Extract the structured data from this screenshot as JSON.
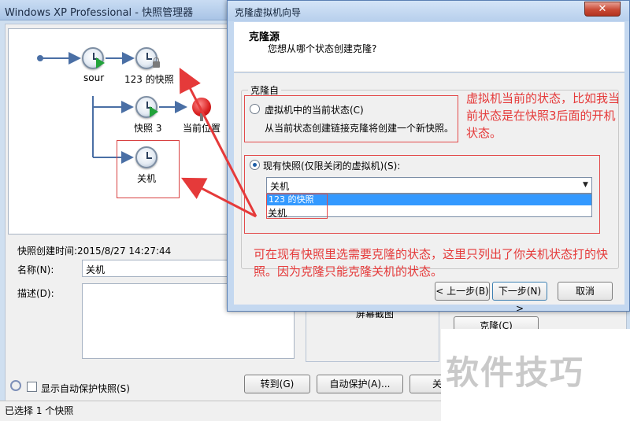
{
  "manager": {
    "title": "Windows XP Professional - 快照管理器",
    "nodes": {
      "sour": "sour",
      "s123": "123 的快照",
      "kz3": "快照 3",
      "current": "当前位置",
      "guanji": "关机"
    },
    "details": {
      "created": "快照创建时间:2015/8/27 14:27:44",
      "name_label": "名称(N):",
      "name_value": "关机",
      "desc_label": "描述(D):",
      "screenshot_label": "屏幕截图"
    },
    "buttons": {
      "clone": "克隆(C)",
      "goto": "转到(G)",
      "autoprotect": "自动保护(A)...",
      "close_partial": "关"
    },
    "show_autoprotect": "显示自动保护快照(S)",
    "status": "已选择 1 个快照"
  },
  "wizard": {
    "title": "克隆虚拟机向导",
    "close_glyph": "✕",
    "header_title": "克隆源",
    "header_subtitle": "您想从哪个状态创建克隆?",
    "group_label": "克隆自",
    "radio_current": "虚拟机中的当前状态(C)",
    "radio_current_desc": "从当前状态创建链接克隆将创建一个新快照。",
    "radio_existing": "现有快照(仅限关闭的虚拟机)(S):",
    "combo_value": "关机",
    "combo_arrow": "▼",
    "options": [
      "123 的快照",
      "关机"
    ],
    "buttons": {
      "back": "< 上一步(B)",
      "next": "下一步(N) >",
      "cancel": "取消"
    }
  },
  "annotations": {
    "right": "虚拟机当前的状态，比如我当前状态是在快照3后面的开机状态。",
    "bottom": "可在现有快照里选需要克隆的状态，这里只列出了你关机状态打的快照。因为克隆只能克隆关机的状态。"
  },
  "watermark": "软件技巧",
  "colors": {
    "annotation_red": "#e53a3a",
    "selection_blue": "#3399ff",
    "play_green": "#22a33a"
  }
}
